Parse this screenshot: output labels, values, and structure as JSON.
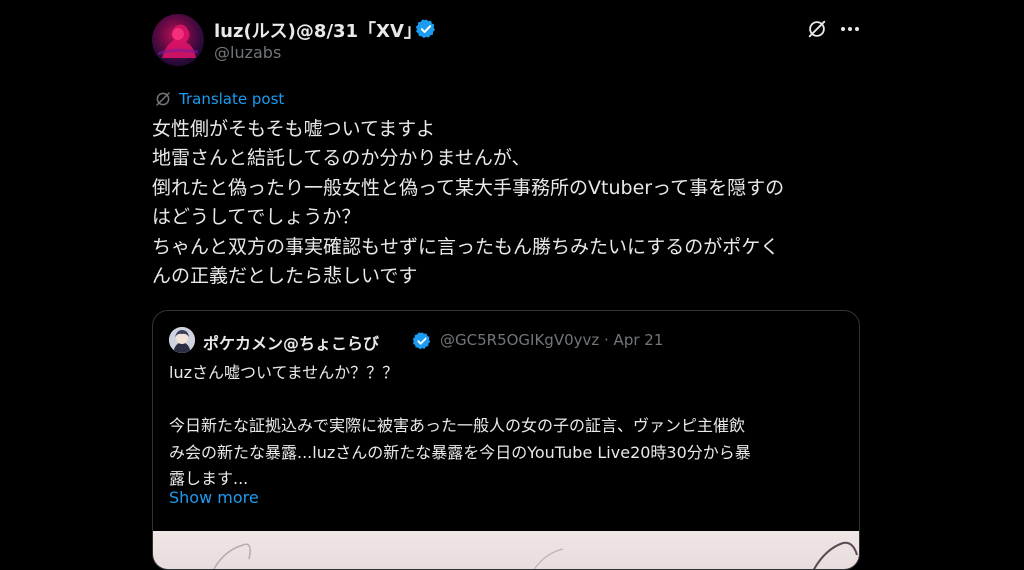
{
  "post": {
    "author": {
      "name": "luz(ルス)@8/31「XV」",
      "handle": "@luzabs"
    },
    "translate_label": "Translate post",
    "body_lines": [
      "女性側がそもそも嘘ついてますよ",
      "地雷さんと結託してるのか分かりませんが、",
      "倒れたと偽ったり一般女性と偽って某大手事務所のVtuberって事を隠すの",
      "はどうしてでしょうか？",
      "ちゃんと双方の事実確認もせずに言ったもん勝ちみたいにするのがポケく",
      "んの正義だとしたら悲しいです"
    ]
  },
  "quote": {
    "author_name": "ポケカメン@ちょこらび",
    "handle_date": "@GC5R5OGIKgV0yvz · Apr 21",
    "lines": [
      "luzさん嘘ついてませんか？？？",
      "",
      "今日新たな証拠込みで実際に被害あった一般人の女の子の証言、ヴァンピ主催飲",
      "み会の新たな暴露...luzさんの新たな暴露を今日のYouTube Live20時30分から暴",
      "露します..."
    ],
    "show_more": "Show more"
  },
  "icons": {
    "verified": "verified-badge-icon",
    "grok": "grok-icon",
    "more": "more-options-icon",
    "translate": "translate-icon"
  },
  "colors": {
    "background": "#000000",
    "text": "#e7e9ea",
    "muted": "#71767b",
    "accent": "#1d9bf0",
    "border": "#2f3336"
  }
}
